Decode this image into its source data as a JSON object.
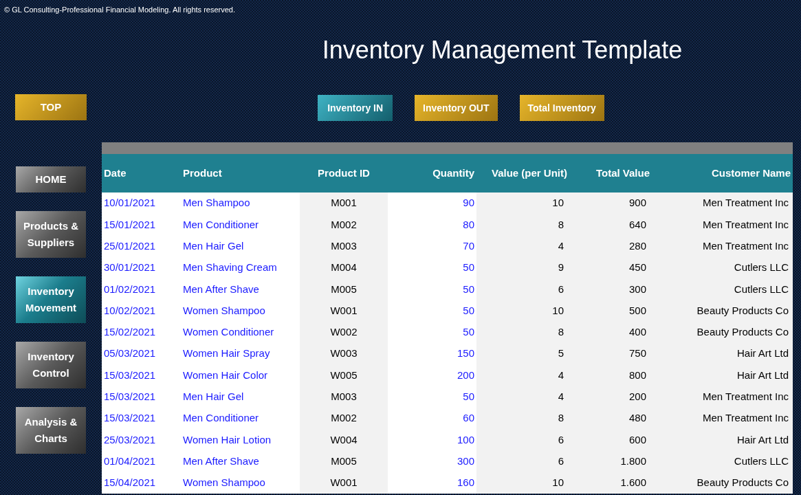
{
  "copyright": "© GL Consulting-Professional Financial Modeling. All rights reserved.",
  "title": "Inventory Management  Template",
  "top_button": "TOP",
  "tabs": [
    {
      "label": "Inventory IN",
      "selected": true
    },
    {
      "label": "Inventory OUT",
      "selected": false
    },
    {
      "label": "Total Inventory",
      "selected": false
    }
  ],
  "sidebar": {
    "items": [
      {
        "label": "HOME",
        "selected": false
      },
      {
        "label": "Products & Suppliers",
        "selected": false
      },
      {
        "label": "Inventory Movement",
        "selected": true
      },
      {
        "label": "Inventory Control",
        "selected": false
      },
      {
        "label": "Analysis & Charts",
        "selected": false
      }
    ]
  },
  "table": {
    "columns": [
      {
        "label": "Date",
        "kind": "input"
      },
      {
        "label": "Product",
        "kind": "input"
      },
      {
        "label": "Product ID",
        "kind": "lookup"
      },
      {
        "label": "Quantity",
        "kind": "input"
      },
      {
        "label": "Value (per Unit)",
        "kind": "lookup"
      },
      {
        "label": "Total Value",
        "kind": "lookup"
      },
      {
        "label": "Customer Name",
        "kind": "lookup"
      }
    ],
    "rows": [
      [
        "10/01/2021",
        "Men Shampoo",
        "M001",
        "90",
        "10",
        "900",
        "Men Treatment Inc"
      ],
      [
        "15/01/2021",
        "Men Conditioner",
        "M002",
        "80",
        "8",
        "640",
        "Men Treatment Inc"
      ],
      [
        "25/01/2021",
        "Men Hair Gel",
        "M003",
        "70",
        "4",
        "280",
        "Men Treatment Inc"
      ],
      [
        "30/01/2021",
        "Men Shaving Cream",
        "M004",
        "50",
        "9",
        "450",
        "Cutlers LLC"
      ],
      [
        "01/02/2021",
        "Men After Shave",
        "M005",
        "50",
        "6",
        "300",
        "Cutlers LLC"
      ],
      [
        "10/02/2021",
        "Women Shampoo",
        "W001",
        "50",
        "10",
        "500",
        "Beauty Products Co"
      ],
      [
        "15/02/2021",
        "Women Conditioner",
        "W002",
        "50",
        "8",
        "400",
        "Beauty Products Co"
      ],
      [
        "05/03/2021",
        "Women Hair Spray",
        "W003",
        "150",
        "5",
        "750",
        "Hair Art Ltd"
      ],
      [
        "15/03/2021",
        "Women Hair Color",
        "W005",
        "200",
        "4",
        "800",
        "Hair Art Ltd"
      ],
      [
        "15/03/2021",
        "Men Hair Gel",
        "M003",
        "50",
        "4",
        "200",
        "Men Treatment Inc"
      ],
      [
        "15/03/2021",
        "Men Conditioner",
        "M002",
        "60",
        "8",
        "480",
        "Men Treatment Inc"
      ],
      [
        "25/03/2021",
        "Women Hair Lotion",
        "W004",
        "100",
        "6",
        "600",
        "Hair Art Ltd"
      ],
      [
        "01/04/2021",
        "Men After Shave",
        "M005",
        "300",
        "6",
        "1.800",
        "Cutlers LLC"
      ],
      [
        "15/04/2021",
        "Women Shampoo",
        "W001",
        "160",
        "10",
        "1.600",
        "Beauty Products Co"
      ]
    ]
  }
}
